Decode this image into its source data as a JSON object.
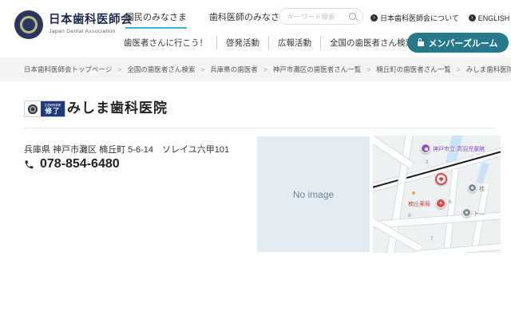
{
  "header": {
    "logo_title": "日本歯科医師会",
    "logo_subtitle": "Japan Dental Association",
    "nav_primary": {
      "item1": "国民のみなさま",
      "item2": "歯科医師のみなさま"
    },
    "search_placeholder": "キーワード検索",
    "about_link": "日本歯科医師会について",
    "english_link": "ENGLISH",
    "nav_secondary": {
      "item1": "歯医者さんに行こう！",
      "item2": "啓発活動",
      "item3": "広報活動",
      "item4": "全国の歯医者さん検索"
    },
    "members_button": "メンバーズルーム"
  },
  "breadcrumb": {
    "separator": ">",
    "items": [
      "日本歯科医師会トップページ",
      "全国の歯医者さん検索",
      "兵庫県の歯医者",
      "神戸市灘区の歯医者さん一覧",
      "楠丘町の歯医者さん一覧",
      "みしま歯科医院"
    ]
  },
  "clinic": {
    "badge_line1": "生涯研修事業",
    "badge_line2": "修了",
    "name": "みしま歯科医院",
    "address": "兵庫県 神戸市灘区 楠丘町 5-6-14　ソレイユ六甲101",
    "phone": "078-854-6480",
    "no_image": "No image"
  },
  "map": {
    "school_label": "神戸市立 高羽児童館",
    "pharmacy_label": "楠丘薬局",
    "gray_label_1": "桂",
    "gray_label_2": "ト―",
    "numbers": {
      "n2": "2",
      "n6": "6",
      "n7": "7",
      "n8": "8"
    }
  },
  "colors": {
    "accent_teal": "#26798b",
    "accent_cyan": "#38b3e3",
    "navy": "#1e2a55",
    "breadcrumb_bg": "#f4f4f5",
    "no_image_bg": "#e3ecf2",
    "map_red": "#e24444",
    "map_purple": "#8a52cc"
  }
}
